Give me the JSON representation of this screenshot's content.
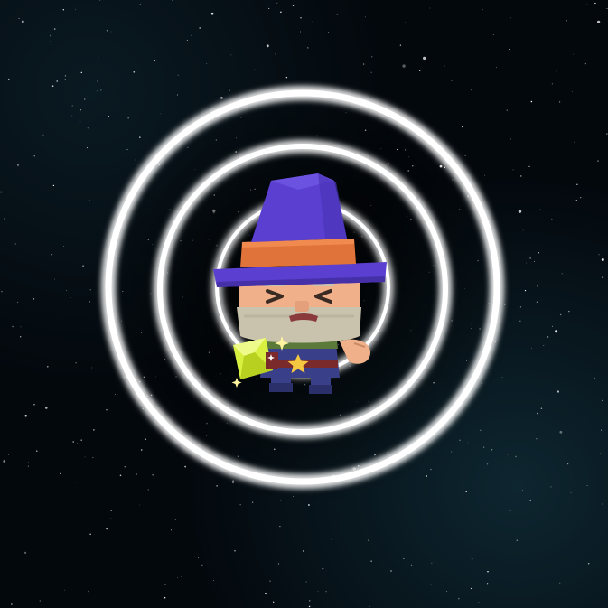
{
  "scene": {
    "background_color": "#03080d",
    "nebula_color": "#0e2630",
    "ring_color": "#ffffff",
    "ring_count": 3
  },
  "character": {
    "type": "wizard",
    "hat_color": "#5a3fd0",
    "hat_band_color": "#e0733a",
    "skin_color": "#f0b08a",
    "beard_color": "#c9c2ad",
    "scarf_color": "#5b7a3a",
    "robe_color": "#3a3f8a",
    "belt_color": "#7a2a2a",
    "expression": "squinting"
  },
  "item": {
    "type": "gem",
    "color": "#d8f040"
  },
  "icons": [
    "star-icon",
    "sparkle-icon"
  ]
}
